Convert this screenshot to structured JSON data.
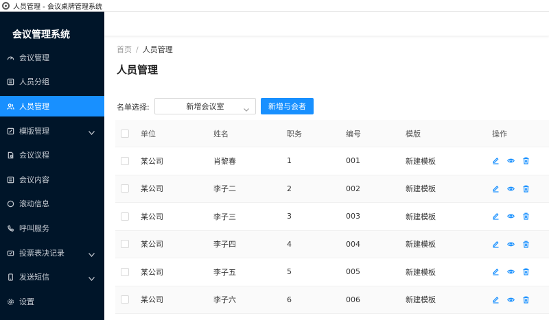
{
  "window": {
    "title": "人员管理 - 会议桌牌管理系统"
  },
  "sidebar": {
    "brand": "会议管理系统",
    "items": [
      {
        "label": "会议管理",
        "icon": "dashboard-icon",
        "active": false,
        "expandable": false
      },
      {
        "label": "人员分组",
        "icon": "list-icon",
        "active": false,
        "expandable": false
      },
      {
        "label": "人员管理",
        "icon": "users-icon",
        "active": true,
        "expandable": false
      },
      {
        "label": "模版管理",
        "icon": "edit-icon",
        "active": false,
        "expandable": true
      },
      {
        "label": "会议议程",
        "icon": "document-icon",
        "active": false,
        "expandable": false
      },
      {
        "label": "会议内容",
        "icon": "list-icon",
        "active": false,
        "expandable": false
      },
      {
        "label": "滚动信息",
        "icon": "message-icon",
        "active": false,
        "expandable": false
      },
      {
        "label": "呼叫服务",
        "icon": "phone-icon",
        "active": false,
        "expandable": false
      },
      {
        "label": "投票表决记录",
        "icon": "vote-icon",
        "active": false,
        "expandable": true
      },
      {
        "label": "发送短信",
        "icon": "mobile-icon",
        "active": false,
        "expandable": true
      },
      {
        "label": "设置",
        "icon": "gear-icon",
        "active": false,
        "expandable": false
      }
    ]
  },
  "breadcrumb": {
    "home": "首页",
    "separator": "/",
    "current": "人员管理"
  },
  "page_title": "人员管理",
  "filter": {
    "label": "名单选择:",
    "selected": "新增会议室"
  },
  "add_button": "新增与会者",
  "table": {
    "headers": [
      "单位",
      "姓名",
      "职务",
      "编号",
      "模版",
      "操作"
    ],
    "rows": [
      {
        "unit": "某公司",
        "name": "肖黎春",
        "role": "1",
        "no": "001",
        "template": "新建模板"
      },
      {
        "unit": "某公司",
        "name": "李子二",
        "role": "2",
        "no": "002",
        "template": "新建模板"
      },
      {
        "unit": "某公司",
        "name": "李子三",
        "role": "3",
        "no": "003",
        "template": "新建模板"
      },
      {
        "unit": "某公司",
        "name": "李子四",
        "role": "4",
        "no": "004",
        "template": "新建模板"
      },
      {
        "unit": "某公司",
        "name": "李子五",
        "role": "5",
        "no": "005",
        "template": "新建模板"
      },
      {
        "unit": "某公司",
        "name": "李子六",
        "role": "6",
        "no": "006",
        "template": "新建模板"
      }
    ],
    "row_actions": [
      "edit-icon",
      "eye-icon",
      "trash-icon"
    ]
  },
  "colors": {
    "sidebar_bg": "#001529",
    "accent": "#1890ff",
    "active_item": "#1890ff"
  }
}
